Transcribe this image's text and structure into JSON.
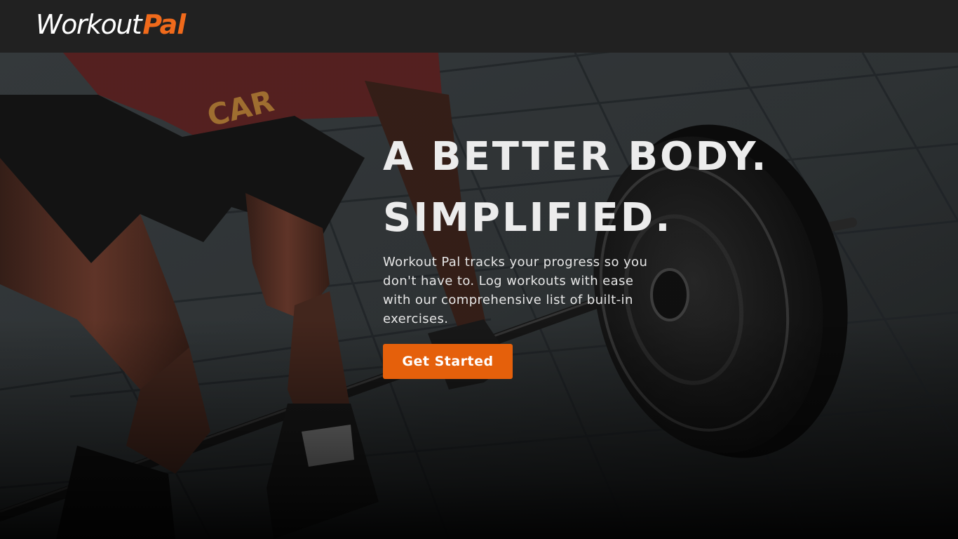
{
  "nav": {
    "logo_part1": "Workout",
    "logo_part2": "Pal"
  },
  "hero": {
    "headline_line1": "A BETTER BODY.",
    "headline_line2": "SIMPLIFIED.",
    "description": "Workout Pal tracks your progress so you don't have to. Log workouts with ease with our comprehensive list of built-in exercises.",
    "cta_label": "Get Started",
    "background_image": "deadlift-barbell-photo"
  },
  "colors": {
    "navbar_bg": "#212121",
    "brand_accent": "#f06a1b",
    "cta_bg": "#e5600b",
    "headline_text": "#ececec"
  }
}
